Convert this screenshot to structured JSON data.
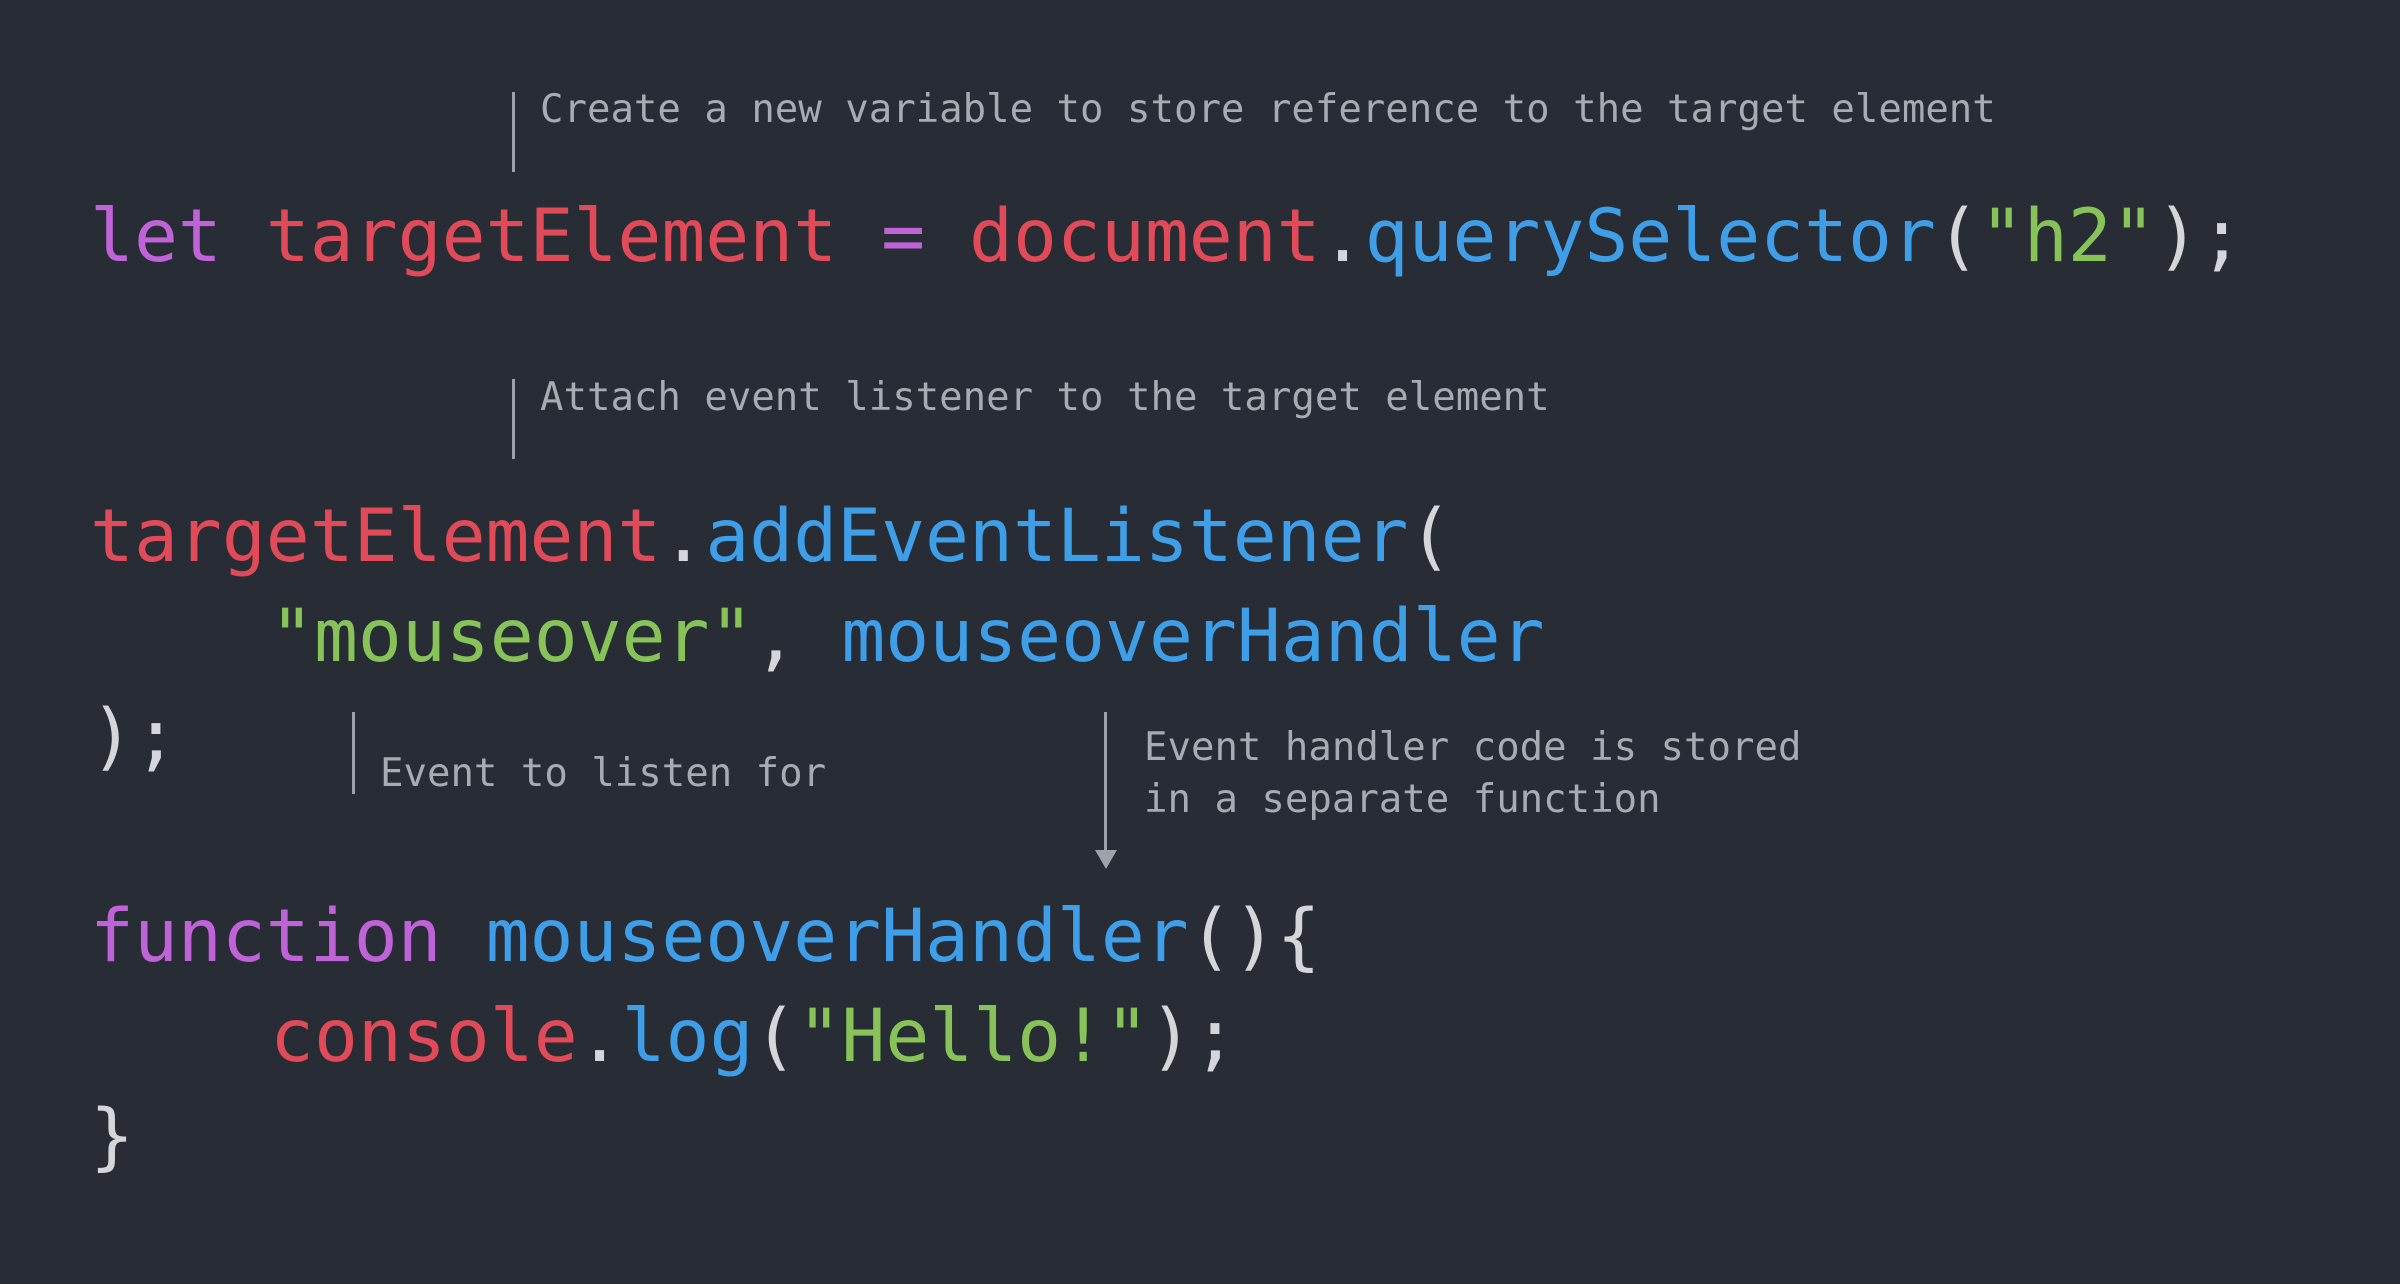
{
  "annotations": {
    "create_variable": "Create a new variable to store reference to the target element",
    "attach_listener": "Attach event listener to the target element",
    "event_to_listen": "Event to listen for",
    "handler_line1": "Event handler code is stored",
    "handler_line2": "in a separate function"
  },
  "code": {
    "line1": {
      "keyword": "let",
      "variable": "targetElement",
      "operator": "=",
      "object": "document",
      "dot": ".",
      "method": "querySelector",
      "open": "(",
      "string": "\"h2\"",
      "close": ");"
    },
    "line2": {
      "object": "targetElement",
      "dot": ".",
      "method": "addEventListener",
      "open": "("
    },
    "line3": {
      "string": "\"mouseover\"",
      "comma": ",",
      "handler": "mouseoverHandler"
    },
    "line4": {
      "close": ");"
    },
    "line5": {
      "keyword": "function",
      "name": "mouseoverHandler",
      "parens": "()",
      "brace": "{"
    },
    "line6": {
      "object": "console",
      "dot": ".",
      "method": "log",
      "open": "(",
      "string": "\"Hello!\"",
      "close": ");"
    },
    "line7": {
      "brace": "}"
    }
  },
  "colors": {
    "background": "#282c34",
    "keyword": "#c062d8",
    "variable": "#e04a59",
    "function": "#3f9ee8",
    "string": "#88c35a",
    "punctuation": "#d3d6db",
    "annotation": "#a7abb2"
  }
}
